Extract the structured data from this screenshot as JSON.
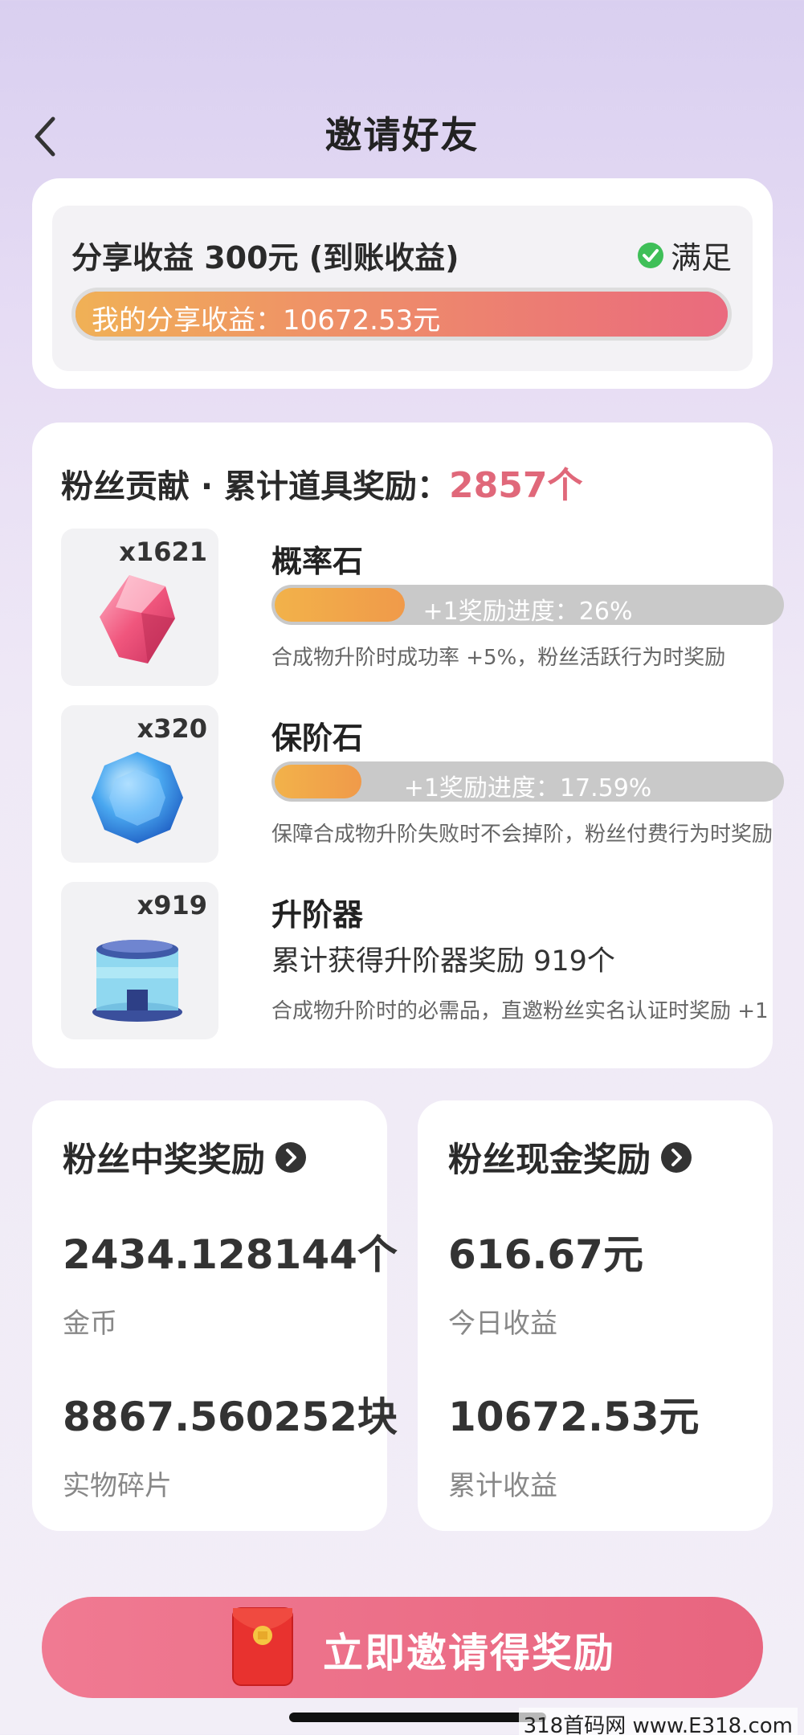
{
  "header": {
    "title": "邀请好友",
    "back_icon": "chevron-left-icon"
  },
  "share": {
    "title": "分享收益 300元 (到账收益)",
    "status": "满足",
    "status_icon": "check-circle-icon",
    "status_color": "#3fbf58",
    "bar_label": "我的分享收益：10672.53元",
    "progress": 1.0
  },
  "fans": {
    "title": "粉丝贡献 · 累计道具奖励：",
    "total": "2857个",
    "accent": "#e0687a",
    "items": [
      {
        "name": "概率石",
        "count": "x1621",
        "icon": "pink-gem-icon",
        "progress_text": "+1奖励进度：26%",
        "progress": 0.26,
        "desc": "合成物升阶时成功率 +5%，粉丝活跃行为时奖励"
      },
      {
        "name": "保阶石",
        "count": "x320",
        "icon": "blue-gem-icon",
        "progress_text": "+1奖励进度：17.59%",
        "progress": 0.1759,
        "desc": "保障合成物升阶失败时不会掉阶，粉丝付费行为时奖励"
      },
      {
        "name": "升阶器",
        "count": "x919",
        "icon": "upgrader-icon",
        "sub": "累计获得升阶器奖励 919个",
        "desc": "合成物升阶时的必需品，直邀粉丝实名认证时奖励 +1"
      }
    ]
  },
  "prize": {
    "title": "粉丝中奖奖励",
    "value1": "2434.128144个",
    "label1": "金币",
    "value2": "8867.560252块",
    "label2": "实物碎片"
  },
  "cash": {
    "title": "粉丝现金奖励",
    "value1": "616.67元",
    "label1": "今日收益",
    "value2": "10672.53元",
    "label2": "累计收益"
  },
  "cta": {
    "label": "立即邀请得奖励",
    "icon": "red-envelope-icon",
    "color": "#ec6f88"
  },
  "watermark": "318首码网 www.E318.com"
}
